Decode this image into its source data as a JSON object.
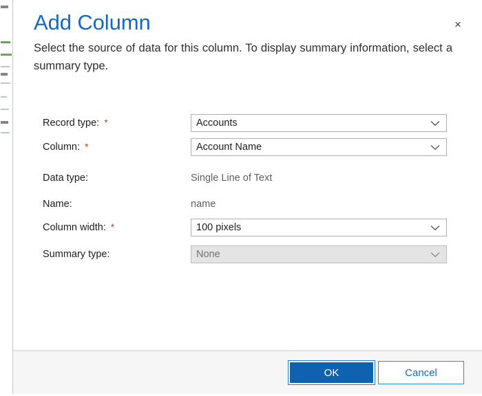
{
  "dialog": {
    "title": "Add Column",
    "description": "Select the source of data for this column. To display summary information, select a summary type.",
    "close_label": "×",
    "required_marker": "*"
  },
  "form": {
    "rows": [
      {
        "label": "Record type:",
        "required": true,
        "type": "select",
        "value": "Accounts",
        "disabled": false
      },
      {
        "label": "Column:",
        "required": true,
        "type": "select",
        "value": "Account Name",
        "disabled": false
      },
      {
        "label": "Data type:",
        "required": false,
        "type": "static",
        "value": "Single Line of Text",
        "disabled": false
      },
      {
        "label": "Name:",
        "required": false,
        "type": "static",
        "value": "name",
        "disabled": false
      },
      {
        "label": "Column width:",
        "required": true,
        "type": "select",
        "value": "100 pixels",
        "disabled": false
      },
      {
        "label": "Summary type:",
        "required": false,
        "type": "select",
        "value": "None",
        "disabled": true
      }
    ]
  },
  "footer": {
    "ok_label": "OK",
    "cancel_label": "Cancel"
  },
  "colors": {
    "title_blue": "#1668bf",
    "accent_blue": "#0f62b0",
    "link_blue": "#1668bf",
    "required_red": "#d83b01",
    "footer_bg": "#f6f6f6",
    "disabled_bg": "#e4e4e4",
    "field_border": "#adadad"
  },
  "icons": {
    "close": "close-icon",
    "chevron": "chevron-down-icon"
  }
}
